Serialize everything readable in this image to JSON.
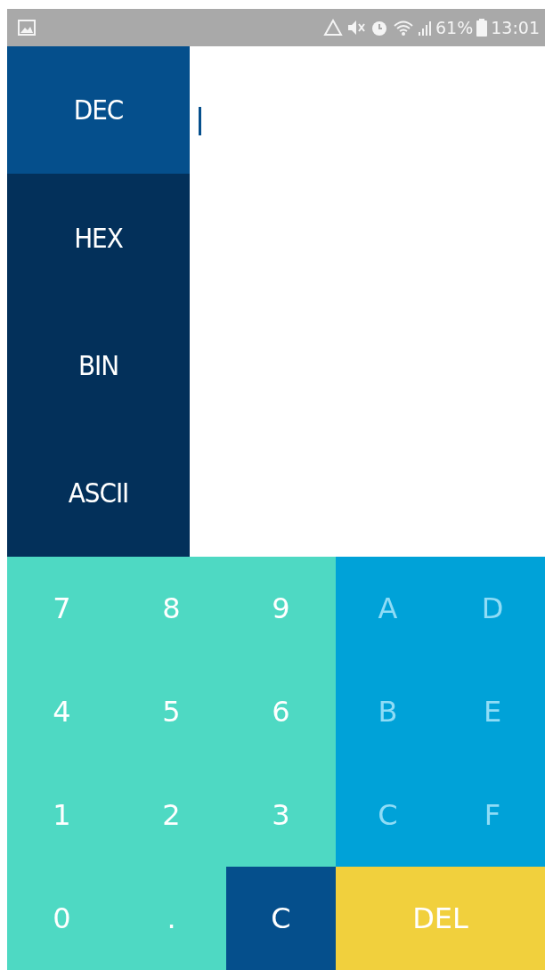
{
  "status_bar": {
    "battery": "61%",
    "time": "13:01"
  },
  "tabs": [
    {
      "label": "DEC",
      "selected": true
    },
    {
      "label": "HEX",
      "selected": false
    },
    {
      "label": "BIN",
      "selected": false
    },
    {
      "label": "ASCII",
      "selected": false
    }
  ],
  "display": {
    "cursor": true
  },
  "keys": [
    {
      "label": "7",
      "kind": "digit",
      "disabled": false
    },
    {
      "label": "8",
      "kind": "digit",
      "disabled": false
    },
    {
      "label": "9",
      "kind": "digit",
      "disabled": false
    },
    {
      "label": "A",
      "kind": "hex",
      "disabled": true
    },
    {
      "label": "D",
      "kind": "hex",
      "disabled": true
    },
    {
      "label": "4",
      "kind": "digit",
      "disabled": false
    },
    {
      "label": "5",
      "kind": "digit",
      "disabled": false
    },
    {
      "label": "6",
      "kind": "digit",
      "disabled": false
    },
    {
      "label": "B",
      "kind": "hex",
      "disabled": true
    },
    {
      "label": "E",
      "kind": "hex",
      "disabled": true
    },
    {
      "label": "1",
      "kind": "digit",
      "disabled": false
    },
    {
      "label": "2",
      "kind": "digit",
      "disabled": false
    },
    {
      "label": "3",
      "kind": "digit",
      "disabled": false
    },
    {
      "label": "C",
      "kind": "hex",
      "disabled": true
    },
    {
      "label": "F",
      "kind": "hex",
      "disabled": true
    },
    {
      "label": "0",
      "kind": "digit",
      "disabled": false
    },
    {
      "label": ".",
      "kind": "digit",
      "disabled": false
    },
    {
      "label": "C",
      "kind": "clear",
      "disabled": false
    },
    {
      "label": "DEL",
      "kind": "delete",
      "disabled": false
    }
  ]
}
